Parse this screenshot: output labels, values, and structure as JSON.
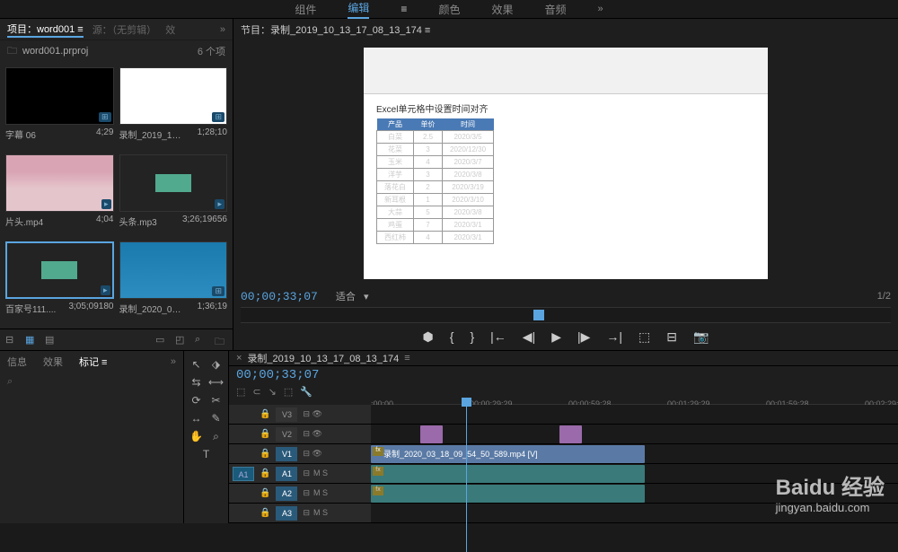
{
  "workspace": {
    "tabs": [
      "组件",
      "编辑",
      "颜色",
      "效果",
      "音频"
    ],
    "active": 1,
    "more": "»"
  },
  "project": {
    "title_prefix": "项目：",
    "title": "word001",
    "source_label": "源：（无剪辑）",
    "effects_label": "效",
    "filename": "word001.prproj",
    "item_count": "6 个项",
    "items": [
      {
        "name": "字幕 06",
        "duration": "4;29",
        "type": "black"
      },
      {
        "name": "录制_2019_10_...",
        "duration": "1;28;10",
        "type": "excel"
      },
      {
        "name": "片头.mp4",
        "duration": "4;04",
        "type": "person"
      },
      {
        "name": "头条.mp3",
        "duration": "3;26;19656",
        "type": "audio"
      },
      {
        "name": "百家号111....",
        "duration": "3;05;09180",
        "type": "audio"
      },
      {
        "name": "录制_2020_03_...",
        "duration": "1;36;19",
        "type": "desktop"
      }
    ]
  },
  "program": {
    "title_prefix": "节目：",
    "title": "录制_2019_10_13_17_08_13_174",
    "timecode": "00;00;33;07",
    "fit": "适合",
    "zoom": "1/2",
    "excel_preview": {
      "title": "Excel单元格中设置时间对齐",
      "headers": [
        "产品",
        "单价",
        "时间"
      ],
      "rows": [
        [
          "白菜",
          "2.5",
          "2020/3/5"
        ],
        [
          "花菜",
          "3",
          "2020/12/30"
        ],
        [
          "玉米",
          "4",
          "2020/3/7"
        ],
        [
          "洋芋",
          "3",
          "2020/3/8"
        ],
        [
          "落花白",
          "2",
          "2020/3/19"
        ],
        [
          "新耳根",
          "1",
          "2020/3/10"
        ],
        [
          "大蒜",
          "5",
          "2020/3/8"
        ],
        [
          "鸡蛋",
          "7",
          "2020/3/1"
        ],
        [
          "西红柿",
          "4",
          "2020/3/1"
        ]
      ]
    }
  },
  "info_panel": {
    "tabs": [
      "信息",
      "效果",
      "标记"
    ],
    "active": 2
  },
  "timeline": {
    "title": "录制_2019_10_13_17_08_13_174",
    "timecode": "00;00;33;07",
    "ruler_ticks": [
      ";00;00",
      "00;00;29;29",
      "00;00;59;28",
      "00;01;29;29",
      "00;01;59;28",
      "00;02;29;29"
    ],
    "tracks": {
      "v3": "V3",
      "v2": "V2",
      "v1": "V1",
      "a1_src": "A1",
      "a1": "A1",
      "a2": "A2",
      "a3": "A3",
      "ms": "M  S"
    },
    "clip_name": "录制_2020_03_18_09_54_50_589.mp4 [V]"
  },
  "watermark": {
    "main": "Baidu 经验",
    "sub": "jingyan.baidu.com"
  }
}
